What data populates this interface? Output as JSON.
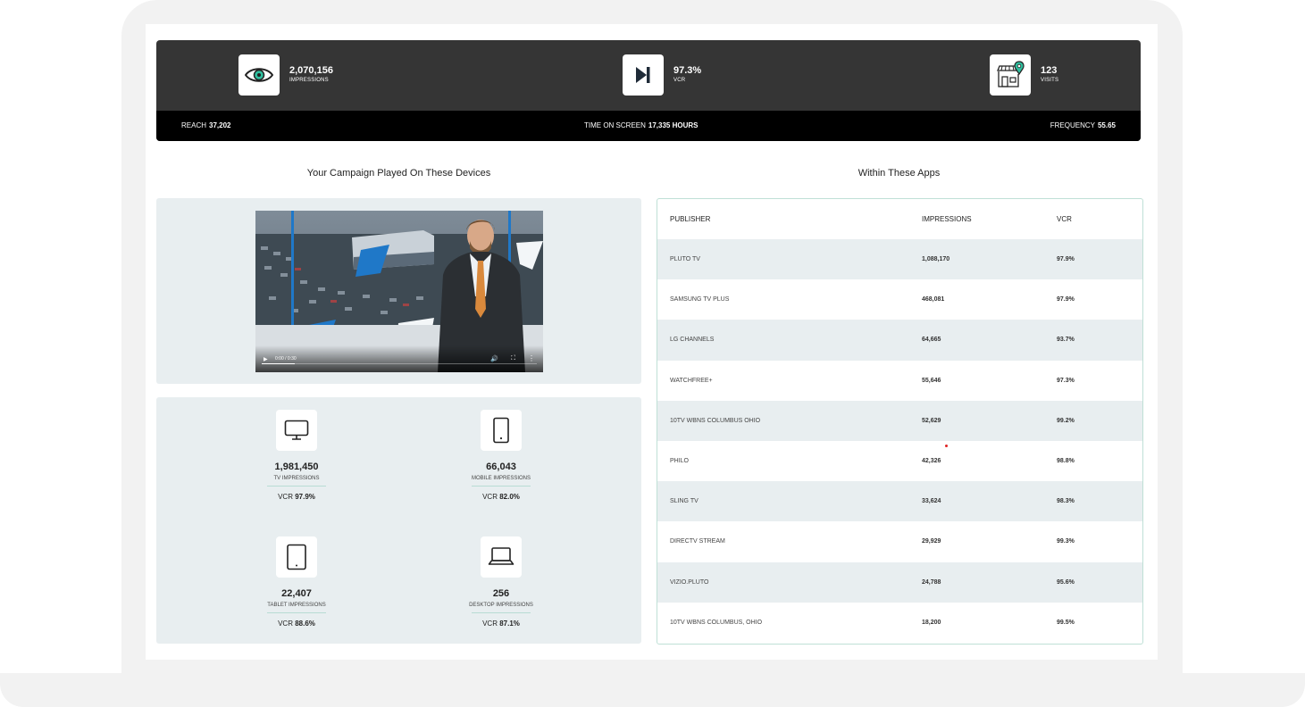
{
  "stats": {
    "impressions": {
      "value": "2,070,156",
      "label": "IMPRESSIONS",
      "icon": "eye-icon"
    },
    "vcr": {
      "value": "97.3%",
      "label": "VCR",
      "icon": "play-skip-icon"
    },
    "visits": {
      "value": "123",
      "label": "VISITS",
      "icon": "store-location-icon"
    }
  },
  "sub_stats": {
    "reach": {
      "label": "REACH",
      "value": "37,202"
    },
    "time_on_screen": {
      "label": "TIME ON SCREEN",
      "value": "17,335 HOURS"
    },
    "frequency": {
      "label": "FREQUENCY",
      "value": "55.65"
    }
  },
  "sections": {
    "devices_title": "Your Campaign Played On These Devices",
    "apps_title": "Within These Apps"
  },
  "video": {
    "time": "0:00 / 0:30",
    "progress": 0.12
  },
  "devices": [
    {
      "value": "1,981,450",
      "label": "TV IMPRESSIONS",
      "vcr_label": "VCR",
      "vcr": "97.9%",
      "icon": "tv-icon"
    },
    {
      "value": "66,043",
      "label": "MOBILE IMPRESSIONS",
      "vcr_label": "VCR",
      "vcr": "82.0%",
      "icon": "mobile-icon"
    },
    {
      "value": "22,407",
      "label": "TABLET IMPRESSIONS",
      "vcr_label": "VCR",
      "vcr": "88.6%",
      "icon": "tablet-icon"
    },
    {
      "value": "256",
      "label": "DESKTOP IMPRESSIONS",
      "vcr_label": "VCR",
      "vcr": "87.1%",
      "icon": "laptop-icon"
    }
  ],
  "table": {
    "headers": [
      "PUBLISHER",
      "IMPRESSIONS",
      "VCR"
    ],
    "rows": [
      [
        "PLUTO TV",
        "1,088,170",
        "97.9%"
      ],
      [
        "SAMSUNG TV PLUS",
        "468,081",
        "97.9%"
      ],
      [
        "LG CHANNELS",
        "64,665",
        "93.7%"
      ],
      [
        "WATCHFREE+",
        "55,646",
        "97.3%"
      ],
      [
        "10TV WBNS COLUMBUS OHIO",
        "52,629",
        "99.2%"
      ],
      [
        "PHILO",
        "42,326",
        "98.8%"
      ],
      [
        "SLING TV",
        "33,624",
        "98.3%"
      ],
      [
        "DIRECTV STREAM",
        "29,929",
        "99.3%"
      ],
      [
        "VIZIO.PLUTO",
        "24,788",
        "95.6%"
      ],
      [
        "10TV WBNS COLUMBUS, OHIO",
        "18,200",
        "99.5%"
      ]
    ]
  },
  "colors": {
    "dark_bar": "#353535",
    "sub_bar": "#000000",
    "panel_bg": "#e8eef0",
    "accent_teal": "#2fbf9f",
    "table_border": "#bfe0d6"
  }
}
